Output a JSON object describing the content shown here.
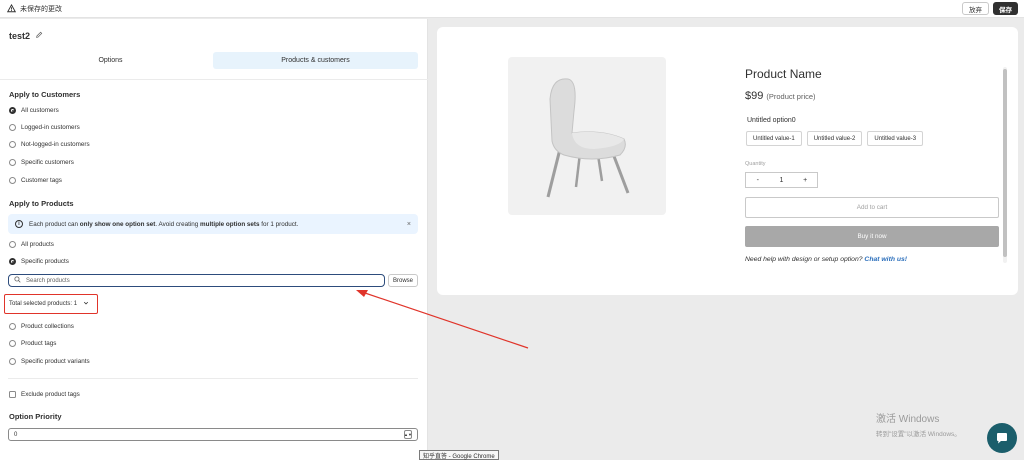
{
  "topbar": {
    "title": "未保存的更改",
    "discard_label": "放弃",
    "save_label": "保存"
  },
  "left": {
    "set_name": "test2",
    "tabs": [
      {
        "label": "Options"
      },
      {
        "label": "Products & customers"
      }
    ],
    "customers": {
      "title": "Apply to Customers",
      "options": [
        {
          "label": "All customers",
          "selected": true
        },
        {
          "label": "Logged-in customers",
          "selected": false
        },
        {
          "label": "Not-logged-in customers",
          "selected": false
        },
        {
          "label": "Specific customers",
          "selected": false
        },
        {
          "label": "Customer tags",
          "selected": false
        }
      ]
    },
    "products": {
      "title": "Apply to Products",
      "banner": {
        "t1": "Each product can ",
        "b1": "only show one option set",
        "t2": ". Avoid creating ",
        "b2": "multiple option sets",
        "t3": " for 1 product."
      },
      "options_top": [
        {
          "label": "All products",
          "selected": false
        },
        {
          "label": "Specific products",
          "selected": true
        }
      ],
      "search_placeholder": "Search products",
      "browse_label": "Browse",
      "total_selected": "Total selected products: 1",
      "options_bottom": [
        {
          "label": "Product collections",
          "selected": false
        },
        {
          "label": "Product tags",
          "selected": false
        },
        {
          "label": "Specific product variants",
          "selected": false
        }
      ]
    },
    "exclude_label": "Exclude product tags",
    "priority": {
      "title": "Option Priority",
      "value": "0"
    }
  },
  "preview": {
    "product_name": "Product Name",
    "price": "$99",
    "price_note": "(Product price)",
    "option_title": "Untitled option0",
    "option_values": [
      "Untitled value-1",
      "Untitled value-2",
      "Untitled value-3"
    ],
    "quantity_label": "Quantity",
    "qty_minus": "-",
    "qty_value": "1",
    "qty_plus": "+",
    "add_to_cart": "Add to cart",
    "buy_now": "Buy it now",
    "help_text": "Need help with design or setup option? ",
    "help_link": "Chat with us!"
  },
  "watermark": {
    "line1": "激活 Windows",
    "line2": "转到\"设置\"以激活 Windows。"
  },
  "tooltip": "知乎直答 - Google Chrome",
  "colors": {
    "accent_highlight": "#e0342a",
    "tab_active_bg": "#e7f3fc",
    "chat_fab": "#1b5e6b"
  }
}
